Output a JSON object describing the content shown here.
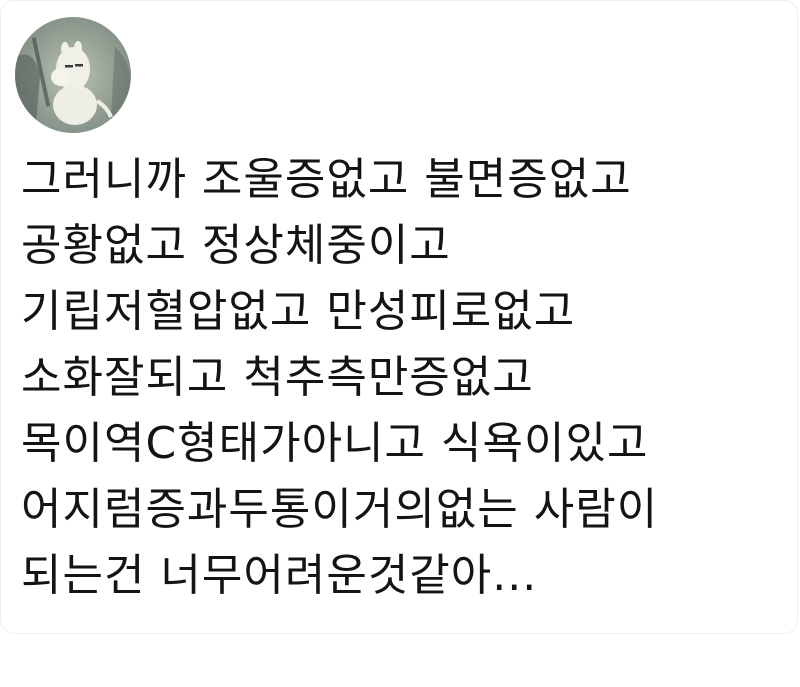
{
  "profile": {
    "avatar_icon": "moomin-avatar-icon"
  },
  "tweet": {
    "lines": [
      "그러니까 조울증없고 불면증없고",
      "공황없고 정상체중이고",
      "기립저혈압없고 만성피로없고",
      "소화잘되고 척추측만증없고",
      "목이역C형태가아니고 식욕이있고",
      "어지럼증과두통이거의없는 사람이",
      "되는건 너무어려운것같아..."
    ]
  },
  "colors": {
    "text": "#141414",
    "background": "#ffffff",
    "card_border": "#eeeeee"
  }
}
